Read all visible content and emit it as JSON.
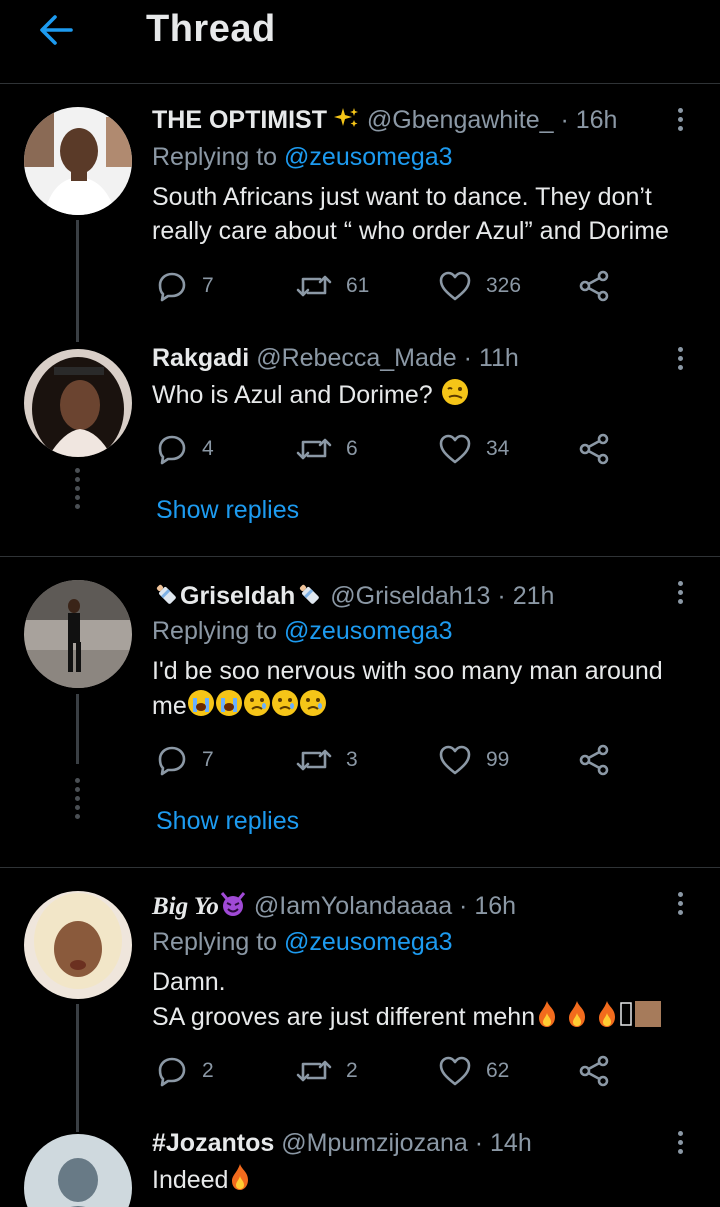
{
  "header": {
    "title": "Thread"
  },
  "tweets": [
    {
      "name": "THE OPTIMIST",
      "handle": "@Gbengawhite_",
      "time": "· 16h",
      "replying_label": "Replying to",
      "replying_to": "@zeusomega3",
      "text_line1": "South Africans just want to dance. They don’t",
      "text_line2": "really care about “ who order Azul” and Dorime",
      "replies": "7",
      "retweets": "61",
      "likes": "326"
    },
    {
      "name": "Rakgadi",
      "handle": "@Rebecca_Made",
      "time": "· 11h",
      "text": "Who is Azul and Dorime?",
      "replies": "4",
      "retweets": "6",
      "likes": "34",
      "show_replies": "Show replies"
    },
    {
      "name": "Griseldah",
      "handle": "@Griseldah13",
      "time": "· 21h",
      "replying_label": "Replying to",
      "replying_to": "@zeusomega3",
      "text_line1": "I'd be soo nervous with soo many man around",
      "text_line2": "me",
      "replies": "7",
      "retweets": "3",
      "likes": "99",
      "show_replies": "Show replies"
    },
    {
      "name": "Big Yo",
      "handle": "@IamYolandaaaa",
      "time": "· 16h",
      "replying_label": "Replying to",
      "replying_to": "@zeusomega3",
      "text_line1": "Damn.",
      "text_line2": "SA grooves are just different mehn",
      "replies": "2",
      "retweets": "2",
      "likes": "62"
    },
    {
      "name": "#Jozantos",
      "handle": "@Mpumzijozana",
      "time": "· 14h",
      "text": "Indeed"
    }
  ],
  "colors": {
    "accent": "#1d9bf0",
    "muted": "#8b98a5",
    "background": "#000000",
    "divider": "#2f3336"
  },
  "icons": [
    "back-arrow-icon",
    "more-icon",
    "reply-icon",
    "retweet-icon",
    "like-icon",
    "share-icon",
    "sparkles-icon",
    "baby-bottle-icon",
    "devil-icon",
    "fire-icon",
    "crying-face-icon",
    "woozy-face-icon"
  ]
}
